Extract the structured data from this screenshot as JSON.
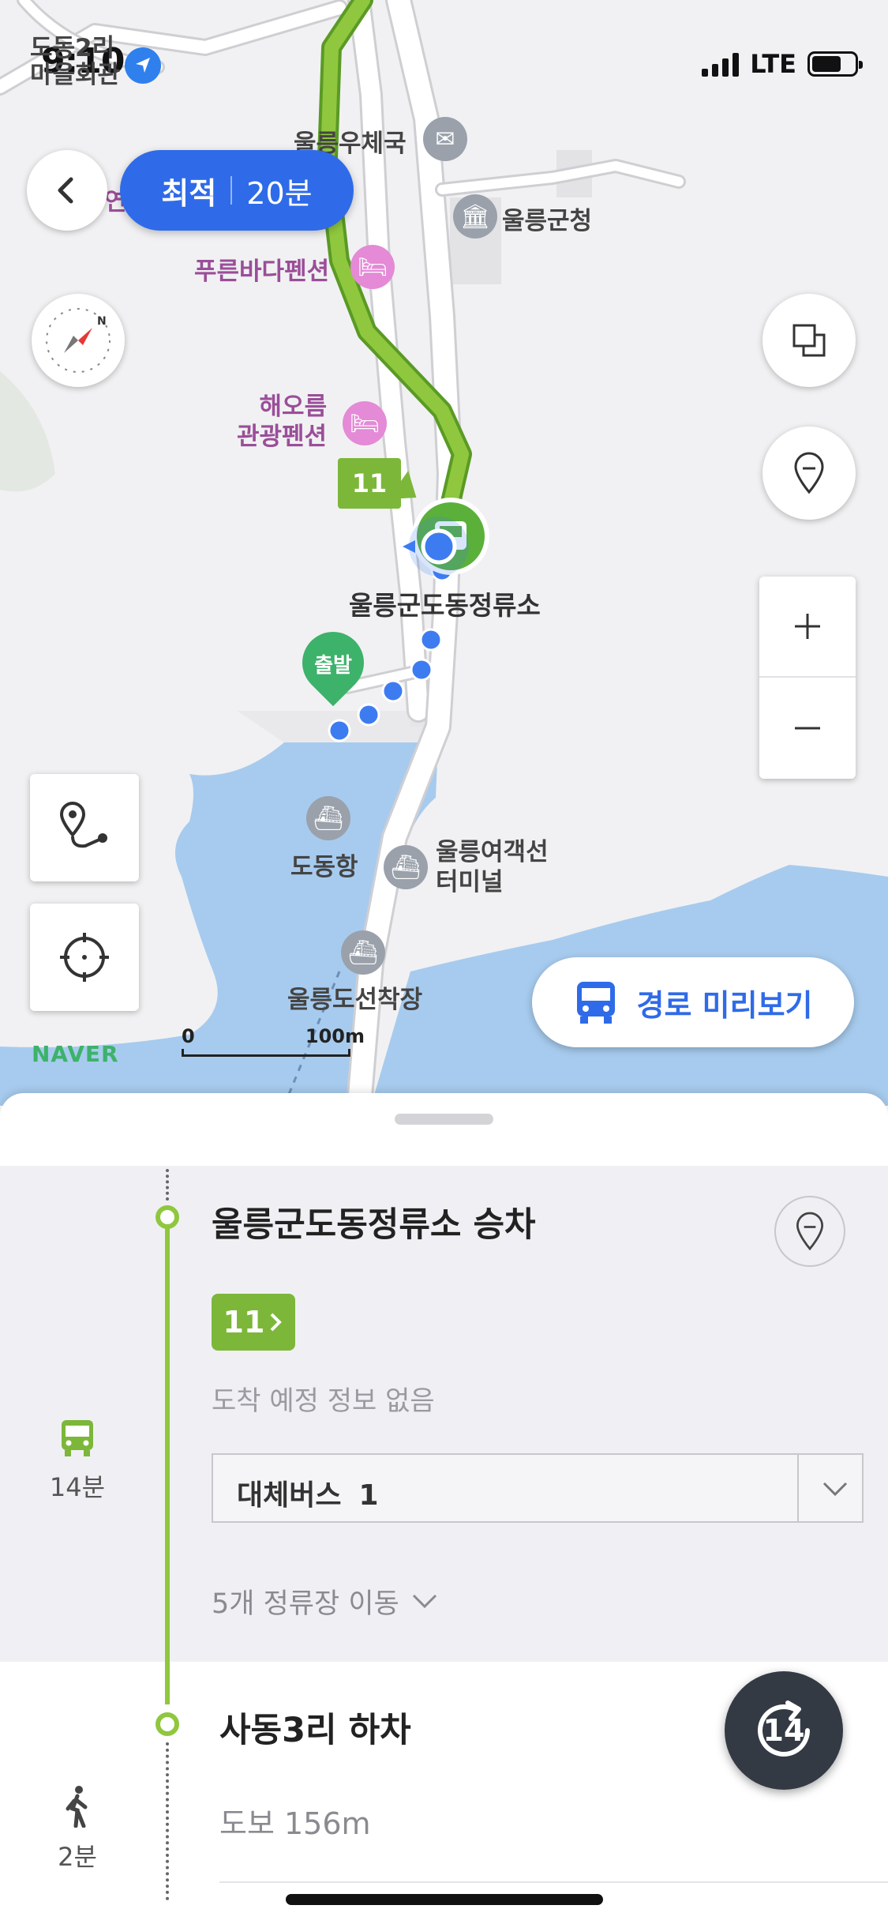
{
  "status_bar": {
    "time": "9:10",
    "network": "LTE"
  },
  "map": {
    "route_summary": {
      "type_label": "최적",
      "duration": "20분"
    },
    "bus_number_tag": "11",
    "start_marker_label": "출발",
    "preview_button_label": "경로 미리보기",
    "logo": "NAVER",
    "scale": {
      "start": "0",
      "end": "100m"
    },
    "pois": {
      "village_hall": "도동2리\n마을회관",
      "partial_label": "연",
      "post_office": "울릉우체국",
      "county_office": "울릉군청",
      "pension_blue": "푸른바다펜션",
      "pension_sunrise": "해오름\n관광펜션",
      "bus_stop_main": "울릉군도동정류소",
      "dodong_port": "도동항",
      "ferry_terminal": "울릉여객선\n터미널",
      "ship_dock": "울릉도선착장"
    },
    "colors": {
      "route_green": "#8fc73e",
      "walk_blue": "#3d7cf0",
      "accent_blue": "#2f6be8",
      "water": "#a7cbee"
    }
  },
  "sheet": {
    "boarding": {
      "title": "울릉군도동정류소 승차",
      "bus_number": "11",
      "arrival_info": "도착 예정 정보 없음",
      "alt_bus_label": "대체버스",
      "alt_bus_count": "1",
      "stops_move": "5개 정류장 이동",
      "ride_minutes": "14분"
    },
    "alighting": {
      "title": "사동3리 하차",
      "walk_distance": "도보 156m",
      "walk_minutes": "2분"
    },
    "refresh_badge": "14"
  }
}
